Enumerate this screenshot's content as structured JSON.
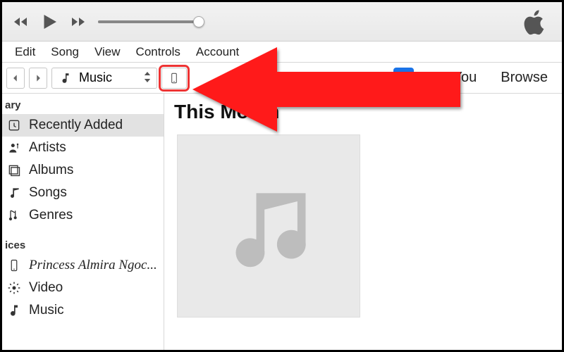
{
  "menubar": [
    "Edit",
    "Song",
    "View",
    "Controls",
    "Account"
  ],
  "toolbar": {
    "media_selector": {
      "icon": "music-note-icon",
      "label": "Music"
    },
    "device_icon": "phone-icon",
    "tabs": {
      "active_partial": "y",
      "for_you": "For You",
      "browse": "Browse"
    }
  },
  "sidebar": {
    "library_header": "ary",
    "library_items": [
      {
        "icon": "clock-icon",
        "label": "Recently Added",
        "selected": true
      },
      {
        "icon": "artist-icon",
        "label": "Artists"
      },
      {
        "icon": "album-icon",
        "label": "Albums"
      },
      {
        "icon": "songs-icon",
        "label": "Songs"
      },
      {
        "icon": "genres-icon",
        "label": "Genres"
      }
    ],
    "devices_header": "ices",
    "device_items": [
      {
        "icon": "phone-icon",
        "label": "Princess Almira Ngoc...",
        "italic": true
      }
    ],
    "extra_items": [
      {
        "icon": "gear-icon",
        "label": "Video"
      },
      {
        "icon": "music-note-icon",
        "label": "Music"
      }
    ]
  },
  "content": {
    "heading": "This Month"
  },
  "colors": {
    "accent": "#1a73e8",
    "highlight": "#ff1a1a"
  }
}
